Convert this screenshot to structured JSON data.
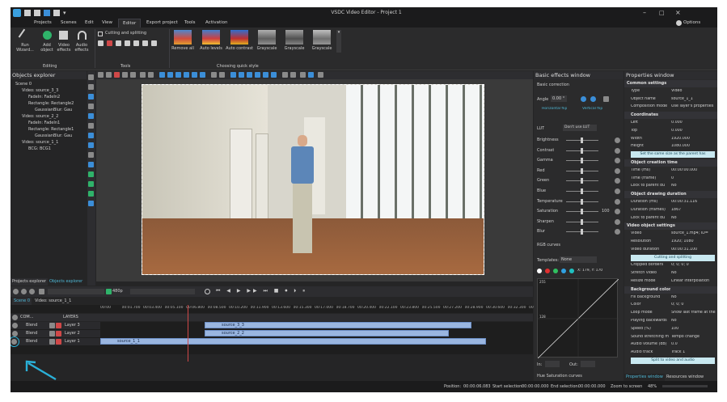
{
  "window": {
    "title": "VSDC Video Editor - Project 1",
    "options": "Options"
  },
  "menu": [
    "Projects",
    "Scenes",
    "Edit",
    "View",
    "Editor",
    "Export project",
    "Tools",
    "Activation"
  ],
  "ribbon": {
    "run_wizard": "Run Wizard...",
    "add_object": "Add object",
    "video_effects": "Video effects",
    "audio_effects": "Audio effects",
    "editing": "Editing",
    "cutting": "Cutting and splitting",
    "tools": "Tools",
    "styles_group": "Choosing quick style",
    "styles": [
      "Remove all",
      "Auto levels",
      "Auto contrast",
      "Grayscale",
      "Grayscale",
      "Grayscale"
    ]
  },
  "objects_explorer": {
    "title": "Objects explorer",
    "items": [
      "Scene 0",
      "Video: source_3_3",
      "FadeIn: FadeIn2",
      "Rectangle: Rectangle2",
      "GaussianBlur: Gau",
      "Video: source_2_2",
      "FadeIn: FadeIn1",
      "Rectangle: Rectangle1",
      "GaussianBlur: Gau",
      "Video: source_1_1",
      "BCG: BCG1"
    ],
    "tabs": [
      "Projects explorer",
      "Objects explorer"
    ]
  },
  "timeline": {
    "zoom": "480p",
    "tabs": [
      "Scene 0",
      "Video: source_1_1"
    ],
    "header": [
      "COM...",
      "LAYERS"
    ],
    "ruler": [
      "00:00",
      "00:01.700",
      "00:03.400",
      "00:05.100",
      "00:06.800",
      "00:08.500",
      "00:10.200",
      "00:11.900",
      "00:13.600",
      "00:15.300",
      "00:17.000",
      "00:18.700",
      "00:20.400",
      "00:22.100",
      "00:23.800",
      "00:25.500",
      "00:27.200",
      "00:28.900",
      "00:30.600",
      "00:32.300",
      "00:34.000"
    ],
    "layers": [
      {
        "blend": "Blend",
        "name": "Layer 3",
        "clip": "source_3_3"
      },
      {
        "blend": "Blend",
        "name": "Layer 2",
        "clip": "source_2_2"
      },
      {
        "blend": "Blend",
        "name": "Layer 1",
        "clip": "source_1_1"
      }
    ]
  },
  "effects": {
    "title": "Basic effects window",
    "section1": "Basic correction",
    "angle_label": "Angle",
    "angle_value": "0.00 °",
    "hflip": "Horizontal flip",
    "vflip": "Vertical flip",
    "lut_label": "LUT",
    "lut_value": "Don't use LUT",
    "sliders": [
      "Brightness",
      "Contrast",
      "Gamma",
      "Red",
      "Green",
      "Blue",
      "Temperature",
      "Saturation",
      "Sharpen",
      "Blur"
    ],
    "saturation_value": "100",
    "rgb": "RGB curves",
    "templates_label": "Templates:",
    "templates_value": "None",
    "xy": "X: 179, Y: 170",
    "curve_top": "255",
    "curve_mid": "128",
    "in_label": "In:",
    "out_label": "Out:",
    "hue": "Hue Saturation curves"
  },
  "properties": {
    "title": "Properties window",
    "rows": [
      {
        "k": "Common settings",
        "v": "",
        "h": 1
      },
      {
        "k": "Type",
        "v": "Video",
        "h": 0
      },
      {
        "k": "Object name",
        "v": "source_1_1",
        "h": 0
      },
      {
        "k": "Composition mode",
        "v": "Use layer's properties",
        "h": 0
      },
      {
        "k": "Coordinates",
        "v": "",
        "h": 2
      },
      {
        "k": "Left",
        "v": "0.000",
        "h": 0
      },
      {
        "k": "Top",
        "v": "0.000",
        "h": 0
      },
      {
        "k": "Width",
        "v": "1920.000",
        "h": 0
      },
      {
        "k": "Height",
        "v": "1080.000",
        "h": 0
      },
      {
        "k": "",
        "v": "Set the same size as the parent has",
        "h": 3
      },
      {
        "k": "Object creation time",
        "v": "",
        "h": 2
      },
      {
        "k": "Time (ms)",
        "v": "00:00:00.000",
        "h": 0
      },
      {
        "k": "Time (frame)",
        "v": "0",
        "h": 0
      },
      {
        "k": "Lock to parent du",
        "v": "No",
        "h": 0
      },
      {
        "k": "Object drawing duration",
        "v": "",
        "h": 2
      },
      {
        "k": "Duration (ms)",
        "v": "00:00:31.116",
        "h": 0
      },
      {
        "k": "Duration (frames)",
        "v": "1867",
        "h": 0
      },
      {
        "k": "Lock to parent du",
        "v": "No",
        "h": 0
      },
      {
        "k": "Video object settings",
        "v": "",
        "h": 1
      },
      {
        "k": "Video",
        "v": "source_1.mp4; ID=",
        "h": 0
      },
      {
        "k": "Resolution",
        "v": "1920; 1080",
        "h": 0
      },
      {
        "k": "Video duration",
        "v": "00:00:31.100",
        "h": 0
      },
      {
        "k": "",
        "v": "Cutting and splitting",
        "h": 3
      },
      {
        "k": "Cropped borders",
        "v": "0; 0; 0; 0",
        "h": 0
      },
      {
        "k": "Stretch video",
        "v": "No",
        "h": 0
      },
      {
        "k": "Resize mode",
        "v": "Linear interpolation",
        "h": 0
      },
      {
        "k": "Background color",
        "v": "",
        "h": 2
      },
      {
        "k": "Fill background",
        "v": "No",
        "h": 0
      },
      {
        "k": "Color",
        "v": "0; 0; 0",
        "h": 0
      },
      {
        "k": "Loop mode",
        "v": "Show last frame at the",
        "h": 0
      },
      {
        "k": "Playing backwards",
        "v": "No",
        "h": 0
      },
      {
        "k": "Speed (%)",
        "v": "100",
        "h": 0
      },
      {
        "k": "Sound stretching m",
        "v": "Tempo change",
        "h": 0
      },
      {
        "k": "Audio volume (dB)",
        "v": "0.0",
        "h": 0
      },
      {
        "k": "Audio track",
        "v": "Track 1",
        "h": 0
      },
      {
        "k": "",
        "v": "Split to video and audio",
        "h": 3
      }
    ],
    "tabs": [
      "Properties window",
      "Resources window"
    ]
  },
  "status": {
    "position_label": "Position:",
    "position": "00:00:06.083",
    "start_label": "Start selection:",
    "start": "00:00:00.000",
    "end_label": "End selection:",
    "end": "00:00:00.000",
    "zoom_label": "Zoom to screen",
    "zoom": "48%"
  }
}
